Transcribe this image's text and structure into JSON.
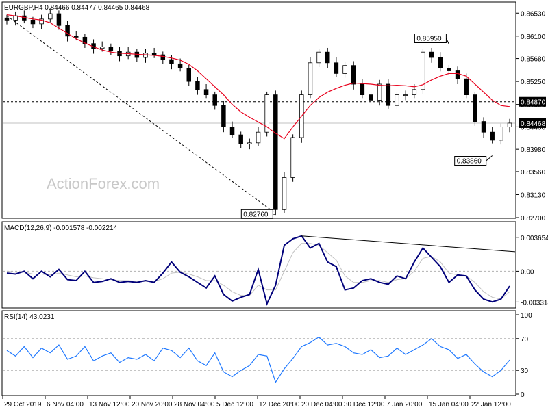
{
  "chart_data": [
    {
      "type": "candlestick",
      "title": "EURGBP,H4  0.84466 0.84477 0.84465 0.84468",
      "watermark": "ActionForex.com",
      "ylim": [
        0.827,
        0.867
      ],
      "y_ticks": [
        "0.86530",
        "0.86100",
        "0.85680",
        "0.85250",
        "0.84820",
        "0.84400",
        "0.83980",
        "0.83560",
        "0.83130",
        "0.82700"
      ],
      "current_price_label": "0.84468",
      "level_label": "0.84870",
      "level_value": 0.8487,
      "annotations": [
        {
          "text": "0.85950",
          "x": "15 Jan 04:00",
          "y": 0.8595
        },
        {
          "text": "0.83860",
          "x": "22 Jan 12:00",
          "y": 0.8386
        },
        {
          "text": "0.82760",
          "x": "12 Dec 20:00",
          "y": 0.8276
        }
      ],
      "ema_color": "#e8001c",
      "candle_color": "#000000",
      "series": [
        {
          "name": "EURGBP close",
          "values": [
            0.864,
            0.8648,
            0.864,
            0.8633,
            0.8642,
            0.8652,
            0.863,
            0.861,
            0.8608,
            0.8596,
            0.8587,
            0.859,
            0.8582,
            0.8573,
            0.858,
            0.857,
            0.8578,
            0.8575,
            0.8566,
            0.8558,
            0.855,
            0.8525,
            0.851,
            0.85,
            0.848,
            0.844,
            0.8425,
            0.8408,
            0.841,
            0.843,
            0.85,
            0.8285,
            0.8345,
            0.842,
            0.85,
            0.856,
            0.858,
            0.856,
            0.854,
            0.8555,
            0.852,
            0.85,
            0.849,
            0.852,
            0.848,
            0.85,
            0.85,
            0.851,
            0.858,
            0.857,
            0.855,
            0.8545,
            0.853,
            0.85,
            0.845,
            0.843,
            0.8415,
            0.844,
            0.8447
          ]
        },
        {
          "name": "EMA",
          "values": [
            0.865,
            0.8648,
            0.8645,
            0.8642,
            0.864,
            0.8635,
            0.8625,
            0.8615,
            0.8605,
            0.8597,
            0.859,
            0.8584,
            0.858,
            0.8578,
            0.8577,
            0.8576,
            0.8575,
            0.8574,
            0.8572,
            0.8569,
            0.8565,
            0.8557,
            0.8545,
            0.853,
            0.8515,
            0.85,
            0.8482,
            0.8468,
            0.8458,
            0.8449,
            0.844,
            0.8428,
            0.8418,
            0.844,
            0.846,
            0.848,
            0.8495,
            0.8505,
            0.8512,
            0.8518,
            0.8522,
            0.8521,
            0.852,
            0.8518,
            0.8517,
            0.8518,
            0.8517,
            0.8515,
            0.8519,
            0.8528,
            0.8535,
            0.854,
            0.854,
            0.8535,
            0.852,
            0.8505,
            0.849,
            0.848,
            0.8478
          ]
        }
      ]
    },
    {
      "type": "line",
      "title": "MACD(12,26,9) -0.001578 -0.002214",
      "ylim": [
        -0.0038,
        0.0043
      ],
      "y_ticks": [
        {
          "label": "0.003654",
          "value": 0.003654
        },
        {
          "label": "0.00",
          "value": 0.0
        },
        {
          "label": "-0.003314",
          "value": -0.003314
        }
      ],
      "series": [
        {
          "name": "MACD",
          "color": "#00007a",
          "values": [
            -0.0002,
            -0.0003,
            0.0,
            -0.0008,
            0.0,
            -0.0006,
            0.0002,
            -0.0009,
            -0.001,
            0.0,
            -0.0012,
            -0.0011,
            -0.0008,
            -0.0012,
            -0.0011,
            -0.0012,
            -0.001,
            -0.0012,
            -0.0002,
            0.001,
            -0.0001,
            -0.0006,
            -0.0012,
            -0.0018,
            -0.0005,
            -0.0025,
            -0.0032,
            -0.0028,
            -0.0025,
            0.0002,
            -0.0035,
            -0.0015,
            0.0028,
            0.0035,
            0.0038,
            0.0025,
            0.003,
            0.001,
            0.0005,
            -0.002,
            -0.0018,
            -0.001,
            -0.0008,
            -0.0012,
            -0.0014,
            -0.0005,
            -0.0008,
            0.001,
            0.0025,
            0.0015,
            0.0005,
            -0.0012,
            -0.0004,
            -0.0005,
            -0.002,
            -0.003,
            -0.0033,
            -0.003,
            -0.0016
          ]
        },
        {
          "name": "Signal",
          "color": "#c0c0c0",
          "values": [
            0.0,
            -0.0001,
            -0.0001,
            -0.0003,
            -0.0003,
            -0.0004,
            -0.0002,
            -0.0004,
            -0.0006,
            -0.0005,
            -0.0007,
            -0.0008,
            -0.0009,
            -0.001,
            -0.001,
            -0.0011,
            -0.0011,
            -0.0011,
            -0.0008,
            -0.0002,
            -0.0001,
            -0.0003,
            -0.0006,
            -0.001,
            -0.001,
            -0.0015,
            -0.0022,
            -0.0026,
            -0.0026,
            -0.0015,
            -0.002,
            -0.002,
            0.0,
            0.002,
            0.003,
            0.003,
            0.0028,
            0.002,
            0.0012,
            -0.0005,
            -0.0012,
            -0.0012,
            -0.001,
            -0.001,
            -0.0012,
            -0.0009,
            -0.0008,
            0.0,
            0.0014,
            0.0016,
            0.001,
            -0.0002,
            -0.0004,
            -0.0005,
            -0.0012,
            -0.0022,
            -0.0028,
            -0.003,
            -0.0022
          ]
        }
      ],
      "trendline_color": "#000000"
    },
    {
      "type": "line",
      "title": "RSI(14) 43.0231",
      "ylim": [
        0,
        100
      ],
      "y_ticks": [
        {
          "label": "100",
          "value": 100
        },
        {
          "label": "70",
          "value": 70
        },
        {
          "label": "30",
          "value": 30
        },
        {
          "label": "0",
          "value": 0
        }
      ],
      "series": [
        {
          "name": "RSI",
          "color": "#1e78ff",
          "values": [
            55,
            48,
            60,
            46,
            58,
            52,
            62,
            44,
            48,
            60,
            42,
            48,
            52,
            40,
            46,
            44,
            50,
            42,
            58,
            55,
            46,
            58,
            42,
            36,
            52,
            28,
            22,
            30,
            36,
            50,
            48,
            15,
            32,
            45,
            60,
            65,
            72,
            62,
            64,
            60,
            52,
            50,
            56,
            46,
            48,
            58,
            50,
            56,
            62,
            70,
            60,
            56,
            45,
            50,
            38,
            28,
            22,
            30,
            43
          ]
        }
      ],
      "x_ticks": [
        "29 Oct 2019",
        "6 Nov 04:00",
        "13 Nov 12:00",
        "20 Nov 20:00",
        "28 Nov 04:00",
        "5 Dec 12:00",
        "12 Dec 20:00",
        "20 Dec 04:00",
        "30 Dec 12:00",
        "7 Jan 20:00",
        "15 Jan 04:00",
        "22 Jan 12:00"
      ]
    }
  ]
}
